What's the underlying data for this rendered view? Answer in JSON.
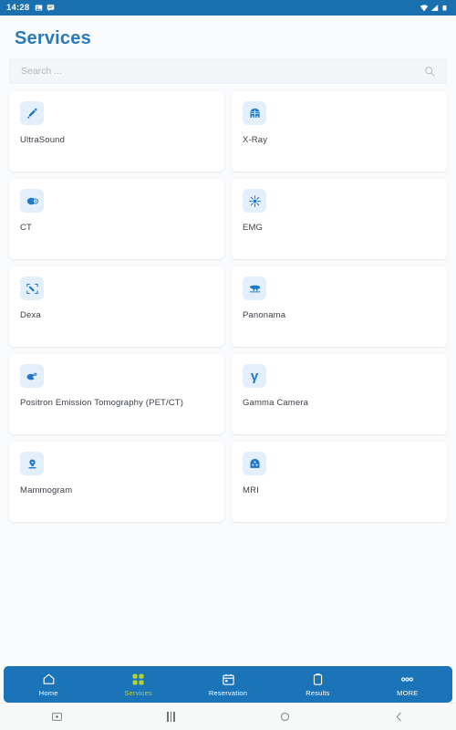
{
  "statusbar": {
    "time": "14:28",
    "left_icons": [
      "image-icon",
      "message-icon"
    ],
    "right_icons": [
      "wifi-icon",
      "signal-icon",
      "battery-icon"
    ]
  },
  "header": {
    "title": "Services"
  },
  "search": {
    "placeholder": "Search ...",
    "value": "",
    "icon": "search-icon"
  },
  "services": [
    {
      "label": "UltraSound",
      "icon": "ultrasound-probe-icon"
    },
    {
      "label": "X-Ray",
      "icon": "ribcage-icon"
    },
    {
      "label": "CT",
      "icon": "ct-scanner-icon"
    },
    {
      "label": "EMG",
      "icon": "nerve-burst-icon"
    },
    {
      "label": "Dexa",
      "icon": "bone-density-icon"
    },
    {
      "label": "Panonama",
      "icon": "dental-panoramic-icon"
    },
    {
      "label": "Positron Emission Tomography (PET/CT)",
      "icon": "pet-scan-icon"
    },
    {
      "label": "Gamma Camera",
      "icon": "gamma-letter-icon"
    },
    {
      "label": "Mammogram",
      "icon": "mammogram-icon"
    },
    {
      "label": "MRI",
      "icon": "mri-head-icon"
    }
  ],
  "bottom_nav": {
    "active_index": 1,
    "items": [
      {
        "label": "Home",
        "icon": "home-icon"
      },
      {
        "label": "Services",
        "icon": "grid-icon"
      },
      {
        "label": "Reservation",
        "icon": "calendar-icon"
      },
      {
        "label": "Results",
        "icon": "clipboard-icon"
      },
      {
        "label": "MORE",
        "icon": "more-dots-icon"
      }
    ]
  },
  "system_nav": {
    "items": [
      "screenshot-icon",
      "recents-icon",
      "home-circle-icon",
      "back-icon"
    ]
  },
  "colors": {
    "brand_blue": "#1b74b8",
    "status_blue": "#1a6fae",
    "title_blue": "#2a7ab9",
    "accent_green": "#b5d334",
    "icon_tile_bg": "#e3f0fb",
    "icon_blue": "#2178c4",
    "page_bg": "#fafbfc",
    "card_bg": "#ffffff"
  }
}
